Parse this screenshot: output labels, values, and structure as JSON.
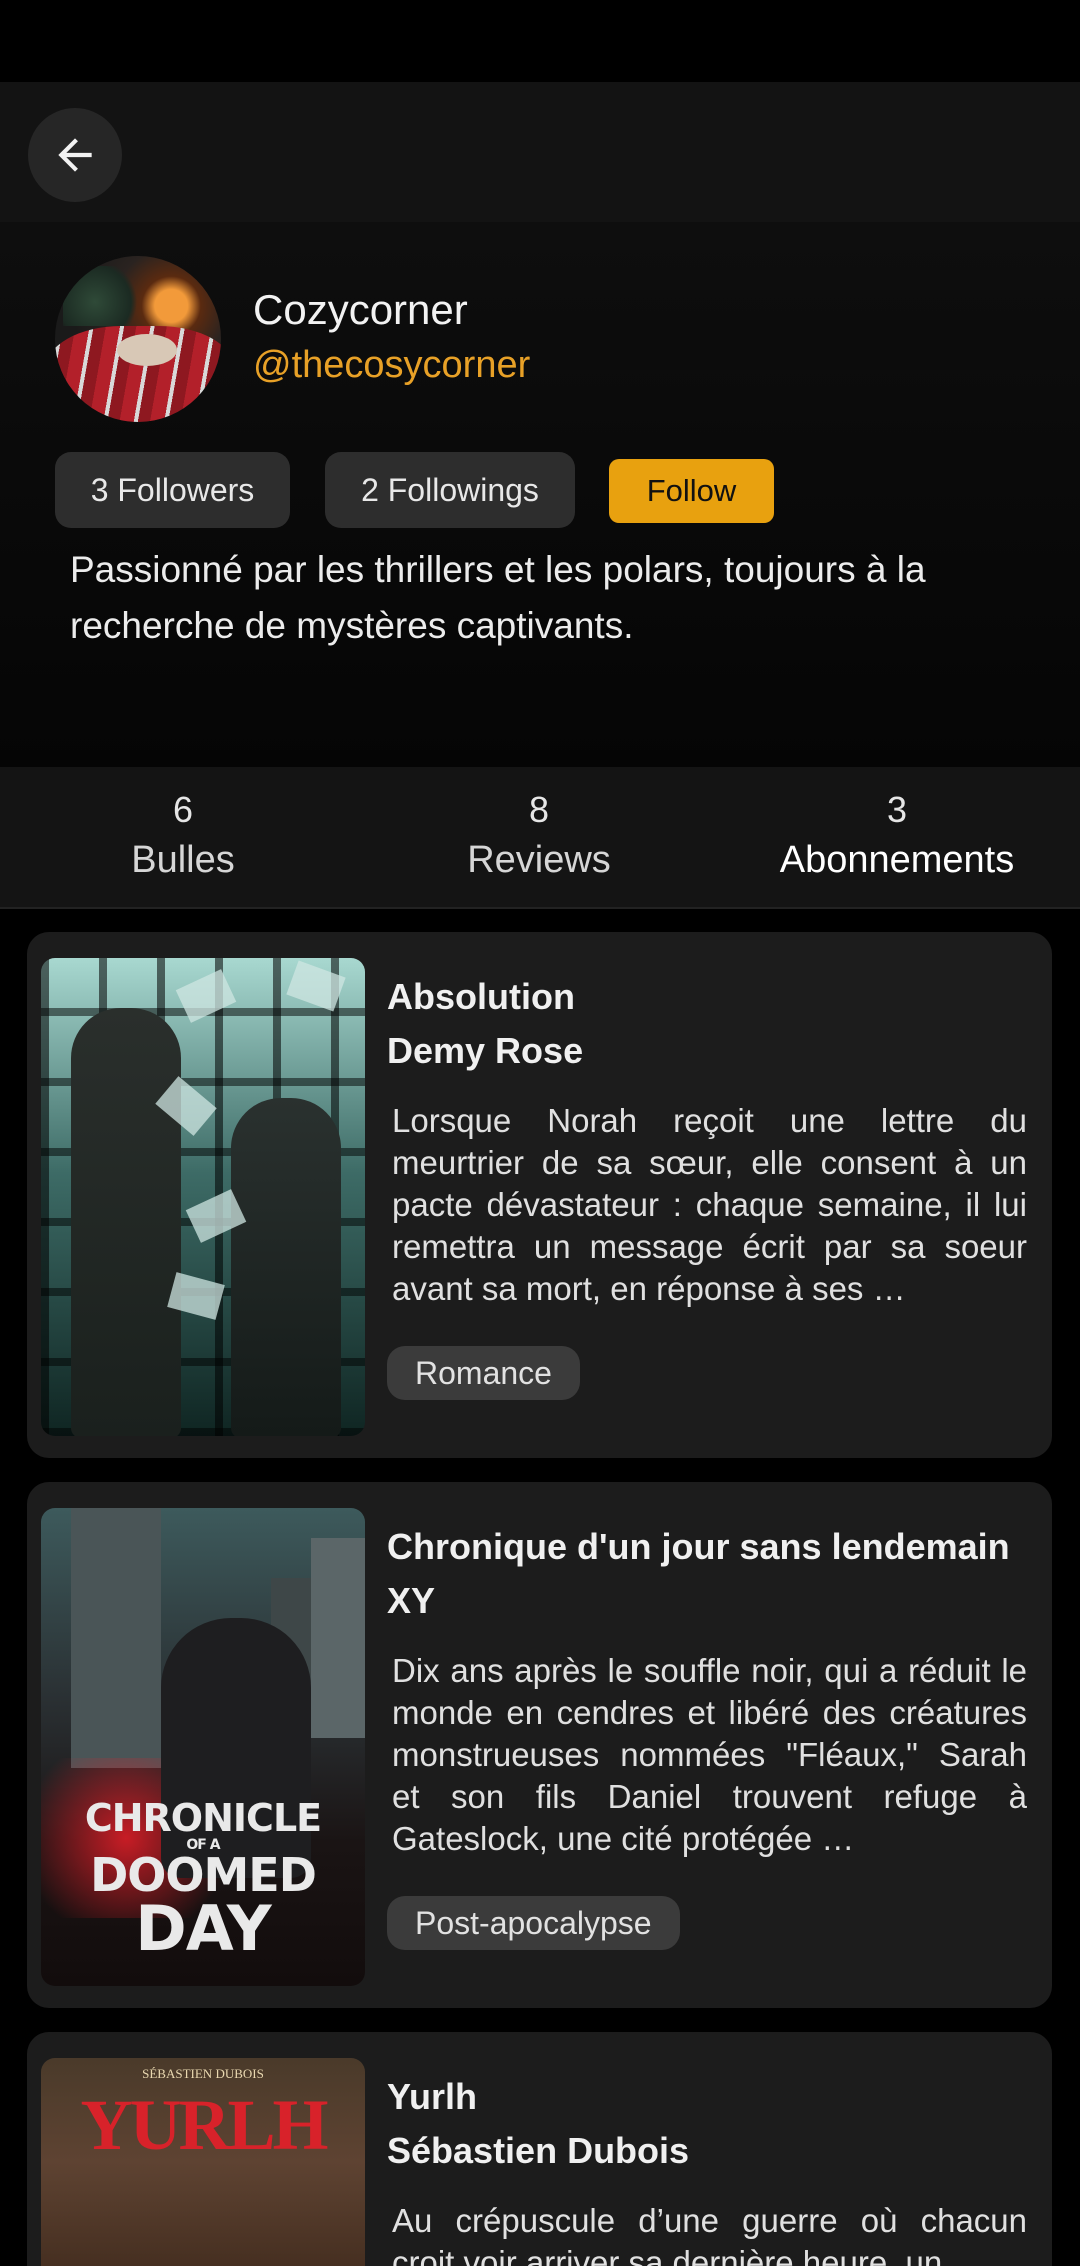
{
  "profile": {
    "display_name": "Cozycorner",
    "handle": "@thecosycorner",
    "followers_label": "3 Followers",
    "followings_label": "2 Followings",
    "follow_label": "Follow",
    "bio": "Passionné par les thrillers et les polars, toujours à la recherche de mystères captivants."
  },
  "stats": [
    {
      "count": "6",
      "label": "Bulles"
    },
    {
      "count": "8",
      "label": "Reviews"
    },
    {
      "count": "3",
      "label": "Abonnements"
    }
  ],
  "books": [
    {
      "title": "Absolution",
      "author": "Demy Rose",
      "synopsis": "Lorsque Norah reçoit une lettre du meurtrier de sa sœur, elle consent à un pacte dévastateur : chaque semaine, il lui remettra un message écrit par sa soeur avant sa mort, en réponse à ses …",
      "genre": "Romance"
    },
    {
      "title": "Chronique d'un jour sans lendemain",
      "author": "XY",
      "synopsis": "Dix ans après le souffle noir, qui a réduit le monde en cendres et libéré des créatures monstrueuses nommées \"Fléaux,\" Sarah et son fils Daniel trouvent refuge à Gateslock, une cité protégée …",
      "genre": "Post-apocalypse",
      "cover_text": [
        "CHRONICLE",
        "OF A",
        "DOOMED",
        "DAY"
      ]
    },
    {
      "title": "Yurlh",
      "author": "Sébastien Dubois",
      "synopsis": "Au crépuscule d’une guerre où chacun croit voir arriver sa dernière heure, un",
      "cover_text": [
        "SÉBASTIEN DUBOIS",
        "YURLH"
      ]
    }
  ],
  "colors": {
    "accent": "#e8a10f",
    "handle": "#e8a127",
    "card_bg": "#1c1c1c",
    "pill_bg": "#2d2d2d"
  },
  "icons": {
    "back": "arrow-left-icon"
  }
}
